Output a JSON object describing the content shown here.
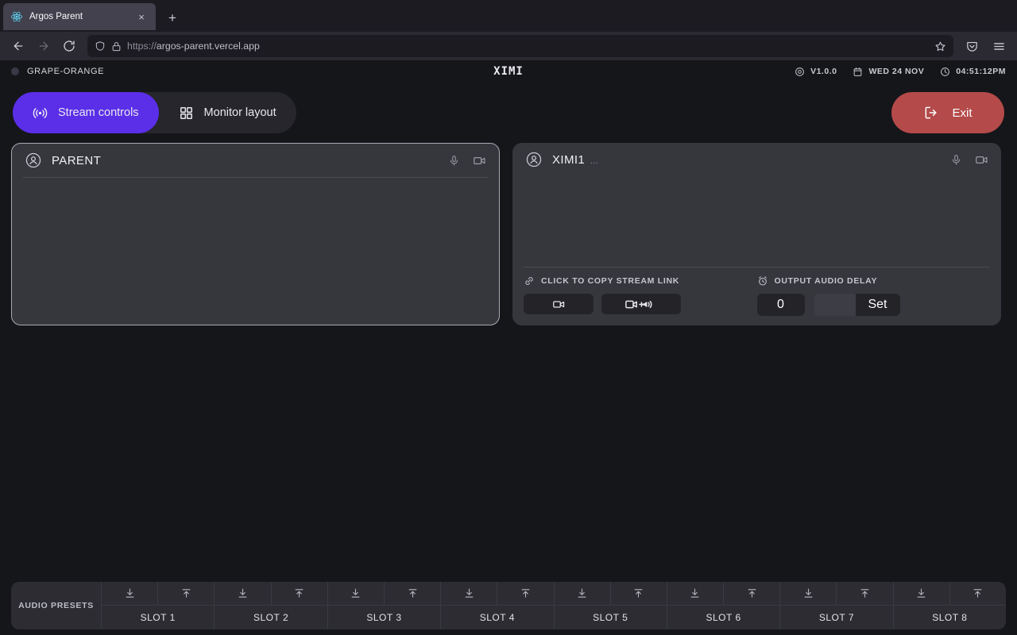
{
  "browser": {
    "tab": {
      "title": "Argos Parent",
      "favicon": "react-icon",
      "close": "×"
    },
    "new_tab_label": "+",
    "nav": {
      "back": "←",
      "forward": "→",
      "reload": "⟳"
    },
    "url": {
      "scheme": "https://",
      "host": "argos-parent.vercel.app",
      "full": "https://argos-parent.vercel.app"
    },
    "icons": [
      "shield-icon",
      "lock-icon",
      "bookmark-star-icon",
      "pocket-icon",
      "menu-icon"
    ]
  },
  "app": {
    "header": {
      "room_name": "GRAPE-ORANGE",
      "logo": "XIMI",
      "version": "V1.0.0",
      "date": "WED 24 NOV",
      "time": "04:51:12PM",
      "status_color": "#3b3746"
    },
    "toolbar": {
      "tabs": [
        {
          "label": "Stream controls",
          "icon": "broadcast-icon",
          "active": true
        },
        {
          "label": "Monitor layout",
          "icon": "grid-icon",
          "active": false
        }
      ],
      "exit_label": "Exit",
      "exit_icon": "logout-icon",
      "accent_color": "#5b2ee8",
      "exit_color": "#b44a4a"
    },
    "panels": [
      {
        "title": "PARENT",
        "subtitle": "",
        "bordered": true,
        "icons": [
          "mic-icon",
          "video-icon"
        ],
        "has_footer": false
      },
      {
        "title": "XIMI1",
        "subtitle": "…",
        "bordered": false,
        "icons": [
          "mic-icon",
          "video-icon"
        ],
        "has_footer": true,
        "footer": {
          "copy_link_label": "CLICK TO COPY STREAM LINK",
          "copy_link_icon": "link-icon",
          "video_button_icon": "video-icon",
          "video_audio_button_icon": "video-plus-audio-icon",
          "delay_label": "OUTPUT AUDIO DELAY",
          "delay_icon": "alarm-clock-icon",
          "delay_value": "0",
          "delay_input_value": "",
          "delay_input_placeholder": "",
          "set_label": "Set"
        }
      }
    ],
    "presets": {
      "label": "AUDIO PRESETS",
      "save_icon": "download-icon",
      "load_icon": "upload-icon",
      "slots": [
        {
          "name": "SLOT 1"
        },
        {
          "name": "SLOT 2"
        },
        {
          "name": "SLOT 3"
        },
        {
          "name": "SLOT 4"
        },
        {
          "name": "SLOT 5"
        },
        {
          "name": "SLOT 6"
        },
        {
          "name": "SLOT 7"
        },
        {
          "name": "SLOT 8"
        }
      ]
    }
  }
}
